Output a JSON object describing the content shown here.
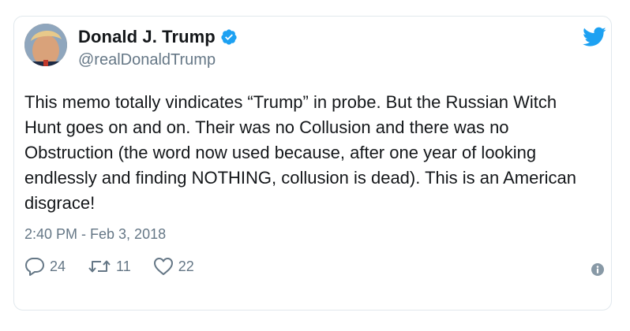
{
  "user": {
    "display_name": "Donald J. Trump",
    "handle": "@realDonaldTrump",
    "verified": true,
    "avatar_icon": "profile-photo"
  },
  "tweet": {
    "text": "This memo totally vindicates “Trump” in probe. But the Russian Witch Hunt goes on and on. Their was no Collusion and there was no Obstruction (the word now used because, after one year of looking endlessly and finding NOTHING, collusion is dead). This is an American disgrace!",
    "timestamp": "2:40 PM - Feb 3, 2018"
  },
  "actions": {
    "replies": "24",
    "retweets": "11",
    "likes": "22"
  },
  "icons": {
    "brand": "twitter-bird-icon",
    "verified": "verified-badge-icon",
    "reply": "reply-icon",
    "retweet": "retweet-icon",
    "like": "heart-icon",
    "info": "info-icon"
  },
  "colors": {
    "brand_blue": "#1da1f2",
    "text_primary": "#14171a",
    "text_secondary": "#657786",
    "border": "#e1e8ed"
  }
}
